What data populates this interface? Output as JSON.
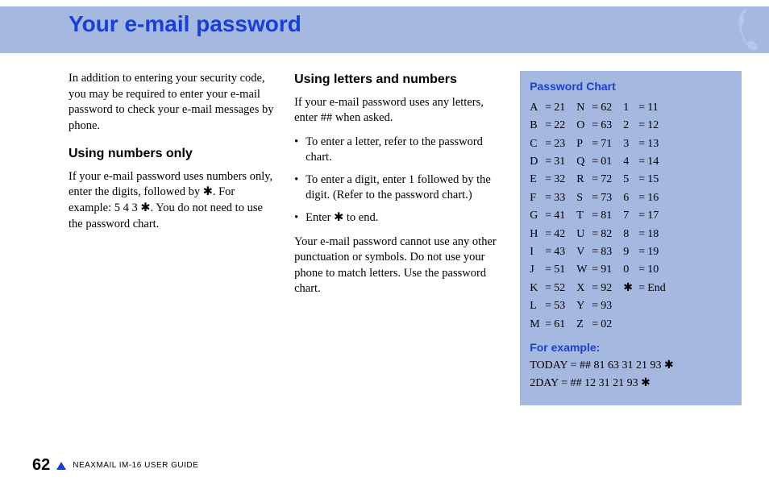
{
  "title": "Your e-mail password",
  "intro": "In addition to entering your security code, you may be required to enter your e-mail password to check your e-mail messages by phone.",
  "section1": {
    "heading": "Using numbers only",
    "body": "If your e-mail password uses numbers only, enter the digits, followed by ✱. For example: 5 4 3 ✱. You do not need to use the password chart."
  },
  "section2": {
    "heading": "Using letters and numbers",
    "p1": "If your e-mail password uses any letters, enter ## when asked.",
    "bullets": [
      "To enter a letter, refer to the password chart.",
      "To enter a digit, enter 1 followed by the digit. (Refer to the password chart.)",
      "Enter ✱ to end."
    ],
    "p2": "Your e-mail password cannot use any other punctuation or symbols. Do not use your phone to match letters. Use the password chart."
  },
  "chart": {
    "title": "Password Chart",
    "col1": [
      {
        "k": "A",
        "v": "21"
      },
      {
        "k": "B",
        "v": "22"
      },
      {
        "k": "C",
        "v": "23"
      },
      {
        "k": "D",
        "v": "31"
      },
      {
        "k": "E",
        "v": "32"
      },
      {
        "k": "F",
        "v": "33"
      },
      {
        "k": "G",
        "v": "41"
      },
      {
        "k": "H",
        "v": "42"
      },
      {
        "k": "I",
        "v": "43"
      },
      {
        "k": "J",
        "v": "51"
      },
      {
        "k": "K",
        "v": "52"
      },
      {
        "k": "L",
        "v": "53"
      },
      {
        "k": "M",
        "v": "61"
      }
    ],
    "col2": [
      {
        "k": "N",
        "v": "62"
      },
      {
        "k": "O",
        "v": "63"
      },
      {
        "k": "P",
        "v": "71"
      },
      {
        "k": "Q",
        "v": "01"
      },
      {
        "k": "R",
        "v": "72"
      },
      {
        "k": "S",
        "v": "73"
      },
      {
        "k": "T",
        "v": "81"
      },
      {
        "k": "U",
        "v": "82"
      },
      {
        "k": "V",
        "v": "83"
      },
      {
        "k": "W",
        "v": "91"
      },
      {
        "k": "X",
        "v": "92"
      },
      {
        "k": "Y",
        "v": "93"
      },
      {
        "k": "Z",
        "v": "02"
      }
    ],
    "col3": [
      {
        "k": "1",
        "v": "11"
      },
      {
        "k": "2",
        "v": "12"
      },
      {
        "k": "3",
        "v": "13"
      },
      {
        "k": "4",
        "v": "14"
      },
      {
        "k": "5",
        "v": "15"
      },
      {
        "k": "6",
        "v": "16"
      },
      {
        "k": "7",
        "v": "17"
      },
      {
        "k": "8",
        "v": "18"
      },
      {
        "k": "9",
        "v": "19"
      },
      {
        "k": "0",
        "v": "10"
      },
      {
        "k": "✱",
        "v": "End"
      }
    ],
    "example_label": "For example:",
    "example1": "TODAY = ## 81 63 31 21 93 ✱",
    "example2": "2DAY = ## 12 31 21 93 ✱"
  },
  "footer": {
    "page_number": "62",
    "guide": "NEAXMAIL IM-16 USER GUIDE"
  }
}
